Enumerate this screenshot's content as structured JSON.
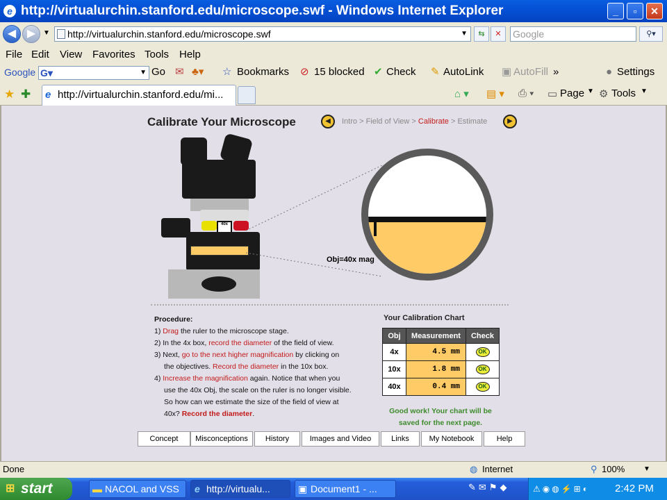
{
  "window": {
    "title": "http://virtualurchin.stanford.edu/microscope.swf - Windows Internet Explorer"
  },
  "address": {
    "url": "http://virtualurchin.stanford.edu/microscope.swf",
    "search_placeholder": "Google"
  },
  "menu": [
    "File",
    "Edit",
    "View",
    "Favorites",
    "Tools",
    "Help"
  ],
  "google_toolbar": {
    "brand": "Google",
    "go": "Go",
    "bookmarks": "Bookmarks",
    "blocked": "15 blocked",
    "check": "Check",
    "autolink": "AutoLink",
    "autofill": "AutoFill",
    "settings": "Settings"
  },
  "tabs": {
    "active": "http://virtualurchin.stanford.edu/mi...",
    "page": "Page",
    "tools": "Tools"
  },
  "page": {
    "title": "Calibrate Your Microscope",
    "breadcrumb": {
      "intro": "Intro",
      "fov": "Field of View",
      "calibrate": "Calibrate",
      "estimate": "Estimate"
    },
    "obj_label": "Obj=40x mag",
    "procedure": {
      "heading": "Procedure:",
      "s1a": "1) ",
      "s1b": "Drag",
      "s1c": " the ruler to the microscope stage.",
      "s2a": "2) In the 4x box, ",
      "s2b": "record the diameter",
      "s2c": " of the field of view.",
      "s3a": "3) Next, ",
      "s3b": "go to the next higher magnification",
      "s3c": " by clicking on",
      "s3d": "the objectives.  ",
      "s3e": "Record the diameter",
      "s3f": " in the 10x box.",
      "s4a": "4) ",
      "s4b": "Increase the magnification",
      "s4c": " again.  Notice that when you",
      "s4d": "use the 40x Obj, the scale on the ruler is no longer visible.",
      "s4e": "So how can we estimate the size of the field of view at",
      "s4f": "40x?  ",
      "s4g": "Record the diameter",
      "s4h": "."
    },
    "chart": {
      "title": "Your Calibration Chart",
      "headers": [
        "Obj",
        "Measurement",
        "Check"
      ],
      "rows": [
        {
          "obj": "4x",
          "meas": "4.5 mm",
          "check": "OK"
        },
        {
          "obj": "10x",
          "meas": "1.8 mm",
          "check": "OK"
        },
        {
          "obj": "40x",
          "meas": "0.4 mm",
          "check": "OK"
        }
      ],
      "message1": "Good work!  Your chart will be",
      "message2": "saved for the next page."
    },
    "nav": [
      "Concept",
      "Misconceptions",
      "History",
      "Images and Video",
      "Links",
      "My Notebook",
      "Help"
    ]
  },
  "status": {
    "text": "Done",
    "zone": "Internet",
    "zoom": "100%"
  },
  "taskbar": {
    "start": "start",
    "tasks": [
      "NACOL and VSS",
      "http://virtualu...",
      "Document1 - ..."
    ],
    "time": "2:42 PM"
  }
}
